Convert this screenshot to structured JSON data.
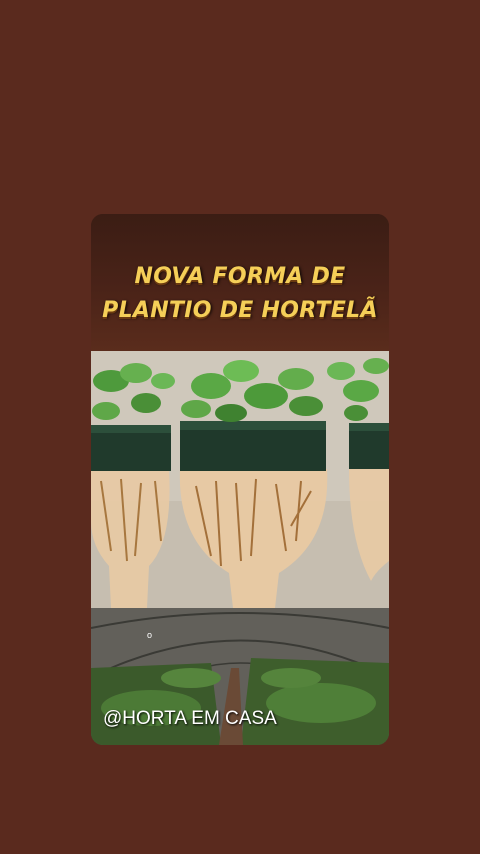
{
  "post": {
    "title_line1": "NOVA FORMA DE",
    "title_line2": "PLANTIO DE HORTELÃ",
    "watermark_handle": "@HORTA EM CASA",
    "overlay_mark": "o"
  },
  "colors": {
    "page_background": "#5a2a1e",
    "title_text": "#f5cf58",
    "title_band": "#4a2318"
  }
}
